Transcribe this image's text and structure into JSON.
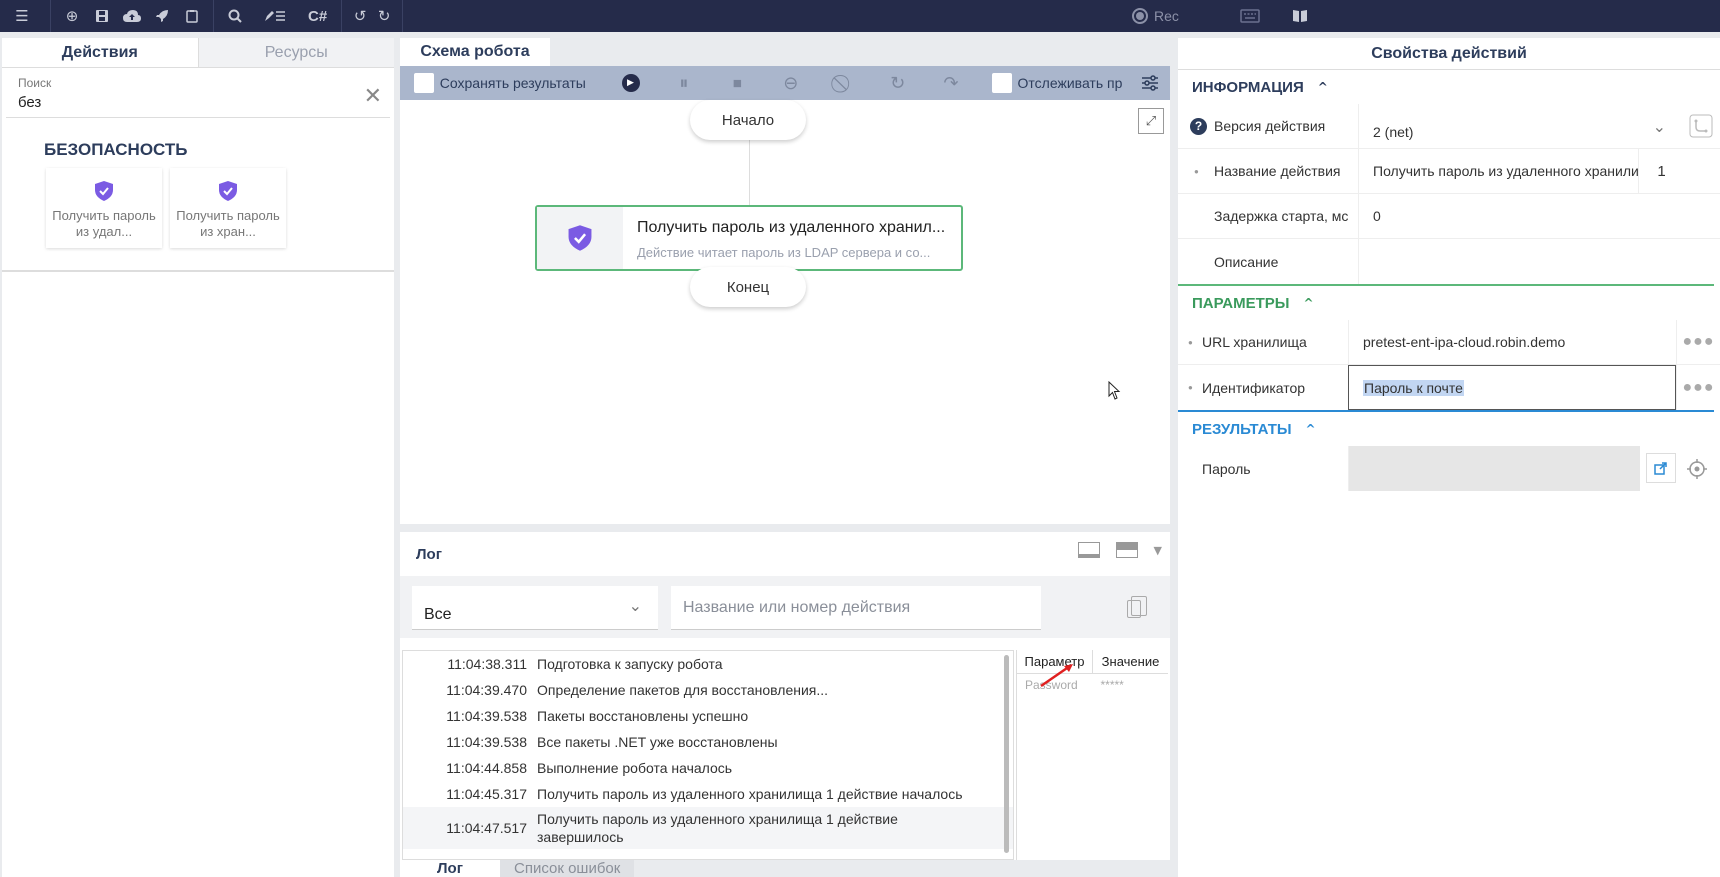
{
  "toolbar": {
    "csharp": "C#",
    "rec": "Rec"
  },
  "left": {
    "tabs": [
      "Действия",
      "Ресурсы"
    ],
    "search": {
      "label": "Поиск",
      "value": "без"
    },
    "category": "БЕЗОПАСНОСТЬ",
    "cards": [
      {
        "label": "Получить пароль из удал..."
      },
      {
        "label": "Получить пароль из хран..."
      }
    ]
  },
  "center": {
    "tab": "Схема робота",
    "save_results": "Сохранять результаты",
    "track": "Отслеживать пр",
    "start": "Начало",
    "end": "Конец",
    "action": {
      "title": "Получить пароль из удаленного хранил...",
      "desc": "Действие читает пароль из LDAP сервера и со..."
    }
  },
  "log": {
    "title": "Лог",
    "filter": "Все",
    "search_placeholder": "Название или номер действия",
    "rows": [
      {
        "time": "11:04:38.311",
        "msg": "Подготовка к запуску робота"
      },
      {
        "time": "11:04:39.470",
        "msg": "Определение пакетов для восстановления..."
      },
      {
        "time": "11:04:39.538",
        "msg": "Пакеты восстановлены успешно"
      },
      {
        "time": "11:04:39.538",
        "msg": "Все пакеты .NET уже восстановлены"
      },
      {
        "time": "11:04:44.858",
        "msg": "Выполнение робота началось"
      },
      {
        "time": "11:04:45.317",
        "msg": "Получить пароль из удаленного хранилища 1 действие началось"
      },
      {
        "time": "11:04:47.517",
        "msg": "Получить пароль из удаленного хранилища 1 действие завершилось"
      }
    ],
    "params_header": [
      "Параметр",
      "Значение"
    ],
    "params": [
      {
        "name": "Password",
        "value": "*****"
      }
    ],
    "bottom_tabs": [
      "Лог",
      "Список ошибок"
    ]
  },
  "right": {
    "title": "Свойства действий",
    "info": {
      "heading": "ИНФОРМАЦИЯ",
      "version_label": "Версия действия",
      "version_value": "2 (net)",
      "name_label": "Название действия",
      "name_value": "Получить пароль из удаленного хранили",
      "name_index": "1",
      "delay_label": "Задержка старта, мс",
      "delay_value": "0",
      "desc_label": "Описание",
      "desc_value": ""
    },
    "params": {
      "heading": "ПАРАМЕТРЫ",
      "url_label": "URL хранилища",
      "url_value": "pretest-ent-ipa-cloud.robin.demo",
      "id_label": "Идентификатор",
      "id_value": "Пароль к почте"
    },
    "results": {
      "heading": "РЕЗУЛЬТАТЫ",
      "pass_label": "Пароль",
      "pass_value": ""
    }
  },
  "colors": {
    "topbar": "#252b4a",
    "accent_green": "#5cb87a",
    "accent_blue": "#2a8ad4",
    "shield": "#7b5be3"
  }
}
